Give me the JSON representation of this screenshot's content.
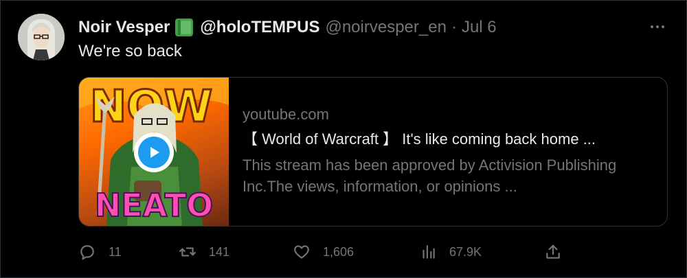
{
  "tweet": {
    "author_name": "Noir Vesper",
    "author_handle_bold": "@holoTEMPUS",
    "author_handle": "@noirvesper_en",
    "separator": "·",
    "date": "Jul 6",
    "text": "We're so back",
    "avatar_icon": "avatar-image",
    "emoji_icon": "green-book-emoji"
  },
  "card": {
    "domain": "youtube.com",
    "title": "【 World of Warcraft 】 It's like coming back home ...",
    "description": "This stream has been approved by Activision Publishing Inc.The views, information, or opinions ...",
    "thumbnail": {
      "top_text": "NOW",
      "bottom_text": "NEATO"
    }
  },
  "actions": {
    "replies": "11",
    "reposts": "141",
    "likes": "1,606",
    "views": "67.9K"
  },
  "colors": {
    "background": "#000000",
    "text_primary": "#e7e9ea",
    "text_secondary": "#71767b",
    "border": "#2f3336",
    "play_blue": "#1d9bf0"
  }
}
